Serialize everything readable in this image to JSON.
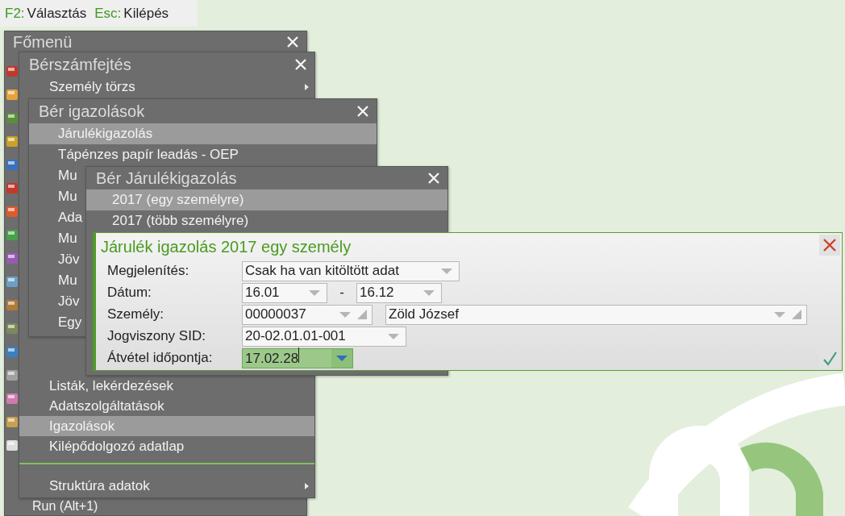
{
  "toolbar": {
    "shortcuts": [
      {
        "key": "F2:",
        "label": "Választás"
      },
      {
        "key": "Esc:",
        "label": "Kilépés"
      }
    ]
  },
  "windows": [
    {
      "title": "Főmenü",
      "items": [
        {
          "label": "Run (Alt+1)",
          "selected": false
        }
      ]
    },
    {
      "title": "Bérszámfejtés",
      "items": [
        {
          "kind": "item",
          "label": "Személy törzs",
          "selected": false,
          "submenu": true
        },
        {
          "kind": "item",
          "label": "Listák, lekérdezések",
          "selected": false,
          "submenu": false
        },
        {
          "kind": "item",
          "label": "Adatszolgáltatások",
          "selected": false,
          "submenu": false
        },
        {
          "kind": "item",
          "label": "Igazolások",
          "selected": true,
          "submenu": false
        },
        {
          "kind": "item",
          "label": "Kilépődolgozó adatlap",
          "selected": false,
          "submenu": false
        },
        {
          "kind": "separator"
        },
        {
          "kind": "item",
          "label": "Struktúra adatok",
          "selected": false,
          "submenu": true
        }
      ]
    },
    {
      "title": "Bér igazolások",
      "items": [
        {
          "label": "Járulékigazolás",
          "selected": true
        },
        {
          "label": "Tápénzes papír leadás - OEP",
          "selected": false
        },
        {
          "label": "Mu",
          "selected": false
        },
        {
          "label": "Mu",
          "selected": false
        },
        {
          "label": "Ada",
          "selected": false
        },
        {
          "label": "Mu",
          "selected": false
        },
        {
          "label": "Jöv",
          "selected": false
        },
        {
          "label": "Mu",
          "selected": false
        },
        {
          "label": "Jöv",
          "selected": false
        },
        {
          "label": "Egy",
          "selected": false
        }
      ]
    },
    {
      "title": "Bér Járulékigazolás",
      "items": [
        {
          "label": "2017 (egy személyre)",
          "selected": true
        },
        {
          "label": "2017 (több személyre)",
          "selected": false
        }
      ]
    }
  ],
  "dialog": {
    "title": "Járulék igazolás 2017 egy személy",
    "rows": [
      {
        "label": "Megjelenítés:",
        "fields": [
          {
            "value": "Csak ha van kitöltött adat",
            "focused": false,
            "lookup": false
          }
        ]
      },
      {
        "label": "Dátum:",
        "separator": "-",
        "fields": [
          {
            "value": "16.01",
            "focused": false,
            "lookup": false
          },
          {
            "value": "16.12",
            "focused": false,
            "lookup": false
          }
        ]
      },
      {
        "label": "Személy:",
        "fields": [
          {
            "value": "00000037",
            "focused": false,
            "lookup": true
          },
          {
            "value": "Zöld József",
            "focused": false,
            "lookup": true
          }
        ]
      },
      {
        "label": "Jogviszony SID:",
        "fields": [
          {
            "value": "20-02.01.01-001",
            "focused": false,
            "lookup": false
          }
        ]
      },
      {
        "label": "Átvétel időpontja:",
        "fields": [
          {
            "value": "17.02.28",
            "focused": true,
            "lookup": false
          }
        ]
      }
    ]
  }
}
